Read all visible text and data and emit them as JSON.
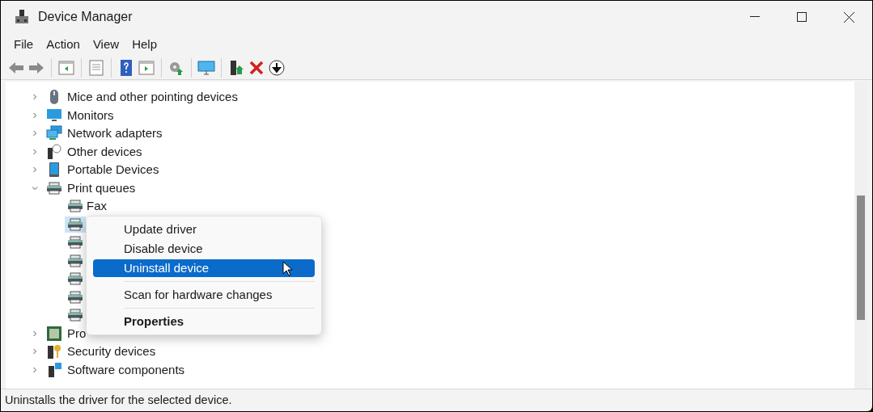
{
  "window": {
    "title": "Device Manager"
  },
  "menu_bar": [
    "File",
    "Action",
    "View",
    "Help"
  ],
  "tree": [
    {
      "label": "Mice and other pointing devices",
      "kind": "mouse",
      "expanded": false
    },
    {
      "label": "Monitors",
      "kind": "monitor",
      "expanded": false
    },
    {
      "label": "Network adapters",
      "kind": "network",
      "expanded": false
    },
    {
      "label": "Other devices",
      "kind": "unknown",
      "expanded": false
    },
    {
      "label": "Portable Devices",
      "kind": "portable",
      "expanded": false
    },
    {
      "label": "Print queues",
      "kind": "printer",
      "expanded": true,
      "children": [
        {
          "label": "Fax",
          "selected": false
        },
        {
          "selected": true
        },
        {
          "selected": false
        },
        {
          "selected": false
        },
        {
          "selected": false
        },
        {
          "selected": false
        },
        {
          "selected": false
        }
      ]
    },
    {
      "label": "Pro",
      "kind": "chip",
      "expanded": false
    },
    {
      "label": "Security devices",
      "kind": "security",
      "expanded": false
    },
    {
      "label": "Software components",
      "kind": "software",
      "expanded": false
    }
  ],
  "context_menu": [
    {
      "kind": "item",
      "label": "Update driver",
      "selected": false
    },
    {
      "kind": "item",
      "label": "Disable device",
      "selected": false
    },
    {
      "kind": "item",
      "label": "Uninstall device",
      "selected": true
    },
    {
      "kind": "separator"
    },
    {
      "kind": "item",
      "label": "Scan for hardware changes",
      "selected": false
    },
    {
      "kind": "separator"
    },
    {
      "kind": "default",
      "label": "Properties",
      "selected": false
    }
  ],
  "status_bar": "Uninstalls the driver for the selected device."
}
